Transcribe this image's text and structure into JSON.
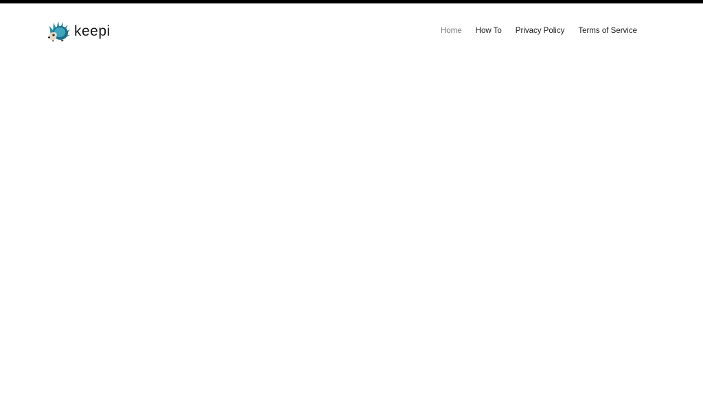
{
  "header": {
    "brand": {
      "name": "keepi",
      "logo_icon": "hedgehog-icon"
    },
    "nav": {
      "items": [
        {
          "label": "Home",
          "active": true
        },
        {
          "label": "How To",
          "active": false
        },
        {
          "label": "Privacy Policy",
          "active": false
        },
        {
          "label": "Terms of Service",
          "active": false
        }
      ]
    }
  },
  "colors": {
    "top_bar": "#000000",
    "nav_active": "#7b7b7b",
    "nav_text": "#1c1c1c",
    "logo_quills": "#2f8ea4",
    "background": "#ffffff"
  }
}
